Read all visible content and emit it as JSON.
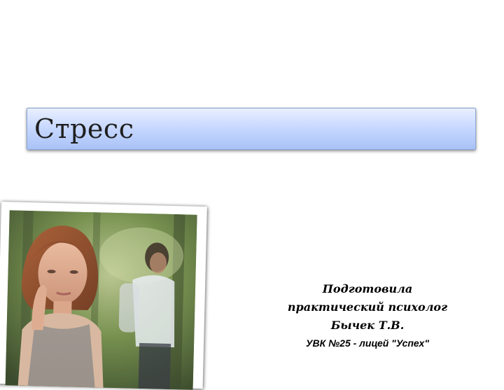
{
  "slide": {
    "title": "Стресс",
    "caption": {
      "line1": "Подготовила",
      "line2": "практический психолог",
      "line3": "Бычек Т.В.",
      "line4": "УВК №25 - лицей \"Успех\""
    },
    "photo": {
      "subject": "woman-with-man-in-background-photo"
    }
  }
}
